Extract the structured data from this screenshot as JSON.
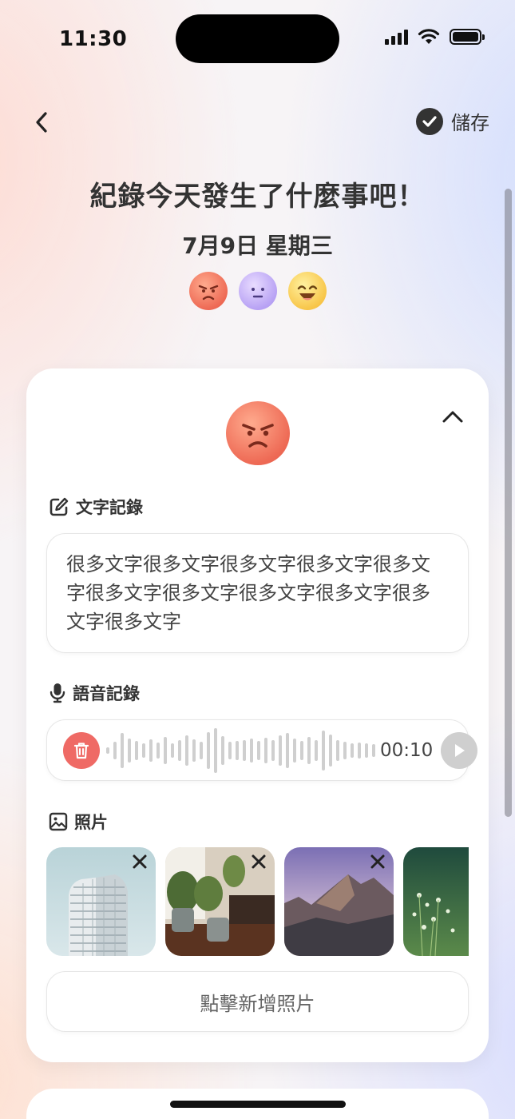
{
  "status_bar": {
    "time": "11:30"
  },
  "nav": {
    "save_label": "儲存"
  },
  "header": {
    "title": "紀錄今天發生了什麼事吧！",
    "date": "7月9日 星期三",
    "moods": [
      "angry-emoji",
      "neutral-emoji",
      "happy-emoji"
    ]
  },
  "entry": {
    "selected_mood": "angry-emoji",
    "text_section_label": "文字記錄",
    "text_content": "很多文字很多文字很多文字很多文字很多文字很多文字很多文字很多文字很多文字很多文字很多文字",
    "voice_section_label": "語音記錄",
    "voice_duration": "00:10",
    "photo_section_label": "照片",
    "photos": [
      "building-photo",
      "plants-photo",
      "mountain-photo",
      "flowers-photo"
    ],
    "add_photo_label": "點擊新增照片"
  },
  "colors": {
    "accent_red": "#ef6a65",
    "text_dark": "#333333",
    "border_light": "#e6e6e6"
  }
}
